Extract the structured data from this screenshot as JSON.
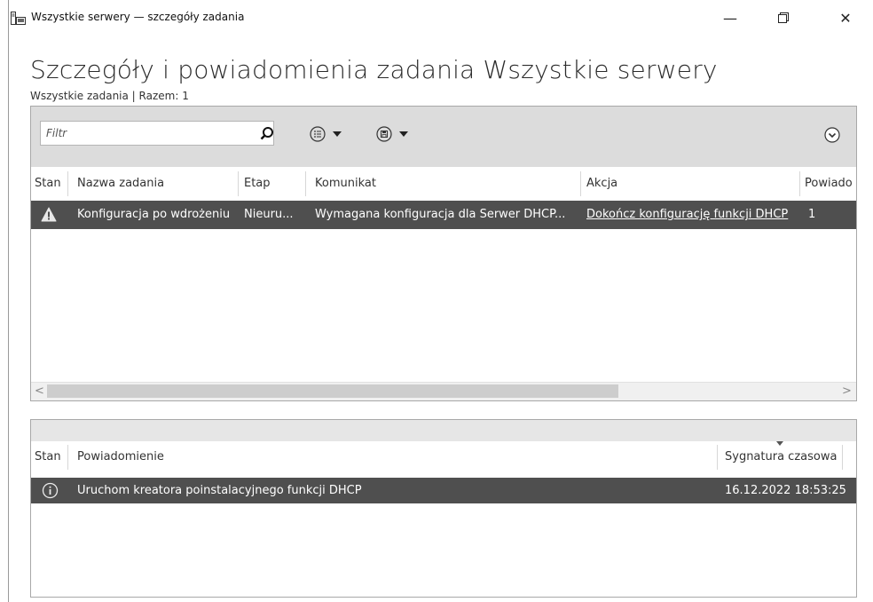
{
  "window": {
    "title": "Wszystkie serwery — szczegóły zadania",
    "minimize_glyph": "—",
    "restore_glyph": "🗗",
    "close_glyph": "✕"
  },
  "page": {
    "title": "Szczegóły i powiadomienia zadania Wszystkie serwery",
    "subtitle": "Wszystkie zadania | Razem: 1"
  },
  "filter": {
    "placeholder": "Filtr",
    "value": ""
  },
  "toolbar": {
    "icons": [
      "search-icon",
      "list-options-icon",
      "save-icon",
      "expand-icon"
    ]
  },
  "tasks_table": {
    "columns": [
      "Stan",
      "Nazwa zadania",
      "Etap",
      "Komunikat",
      "Akcja",
      "Powiado"
    ],
    "rows": [
      {
        "status_icon": "warning-icon",
        "name": "Konfiguracja po wdrożeniu",
        "stage": "Nieuru...",
        "message": "Wymagana konfiguracja dla Serwer DHCP...",
        "action": "Dokończ konfigurację funkcji DHCP",
        "notifications": "1"
      }
    ]
  },
  "scrollbar": {
    "left_arrow": "<",
    "right_arrow": ">"
  },
  "notifications_table": {
    "columns": [
      "Stan",
      "Powiadomienie",
      "Sygnatura czasowa"
    ],
    "rows": [
      {
        "status_icon": "info-icon",
        "notification": "Uruchom kreatora poinstalacyjnego funkcji DHCP",
        "timestamp": "16.12.2022 18:53:25"
      }
    ]
  },
  "colors": {
    "selected_row": "#4f4f4f",
    "toolbar_bg": "#dcdcdc",
    "panel_border": "#a8a8a8"
  }
}
